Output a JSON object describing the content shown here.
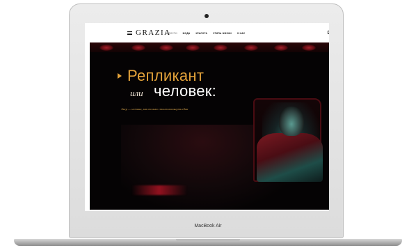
{
  "device": {
    "brand_label": "MacBook Air"
  },
  "site": {
    "logo": "GRAZIA",
    "nav": [
      "НОВОСТИ",
      "МОДА",
      "КРАСОТА",
      "СТИЛЬ ЖИЗНИ",
      "О НАС"
    ],
    "icons": [
      "menu-icon",
      "mail-icon",
      "search-icon",
      "theme-toggle-icon"
    ]
  },
  "hero": {
    "title_line1": "Репликант",
    "connector": "или",
    "title_line2": "человек:",
    "subtitle": "Акер — истина, как только стоит взглянуть едва"
  },
  "colors": {
    "accent": "#e3a23a",
    "hero_bg": "#050304",
    "red": "#a3202a",
    "teal": "#3c9690"
  }
}
